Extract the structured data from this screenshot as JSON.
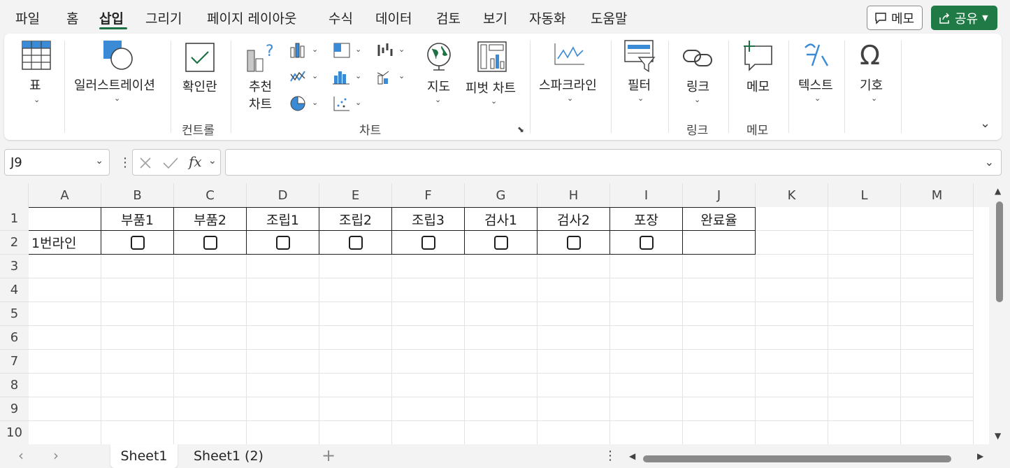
{
  "menu": {
    "tabs": [
      "파일",
      "홈",
      "삽입",
      "그리기",
      "페이지 레이아웃",
      "수식",
      "데이터",
      "검토",
      "보기",
      "자동화",
      "도움말"
    ],
    "active": "삽입",
    "memo_button": "메모",
    "share_button": "공유"
  },
  "ribbon": {
    "table": "표",
    "illustrations": "일러스트레이션",
    "checkbox": "확인란",
    "recommended_charts_1": "추천",
    "recommended_charts_2": "차트",
    "maps": "지도",
    "pivot_chart": "피벗 차트",
    "sparklines": "스파크라인",
    "filter": "필터",
    "link": "링크",
    "memo": "메모",
    "text": "텍스트",
    "symbols": "기호",
    "groups": {
      "controls": "컨트롤",
      "charts": "차트",
      "links": "링크",
      "memos": "메모"
    }
  },
  "formula_bar": {
    "name_box": "J9",
    "formula": ""
  },
  "grid": {
    "columns": [
      "A",
      "B",
      "C",
      "D",
      "E",
      "F",
      "G",
      "H",
      "I",
      "J",
      "K",
      "L",
      "M"
    ],
    "rows": [
      "1",
      "2",
      "3",
      "4",
      "5",
      "6",
      "7",
      "8",
      "9",
      "10"
    ],
    "header_row": [
      "",
      "부품1",
      "부품2",
      "조립1",
      "조립2",
      "조립3",
      "검사1",
      "검사2",
      "포장",
      "완료율"
    ],
    "line_label": "1번라인"
  },
  "sheets": {
    "tabs": [
      "Sheet1",
      "Sheet1 (2)"
    ],
    "active": "Sheet1"
  },
  "colors": {
    "accent": "#1e7145",
    "share": "#1f7a45",
    "icon_blue": "#3a8ad6"
  }
}
